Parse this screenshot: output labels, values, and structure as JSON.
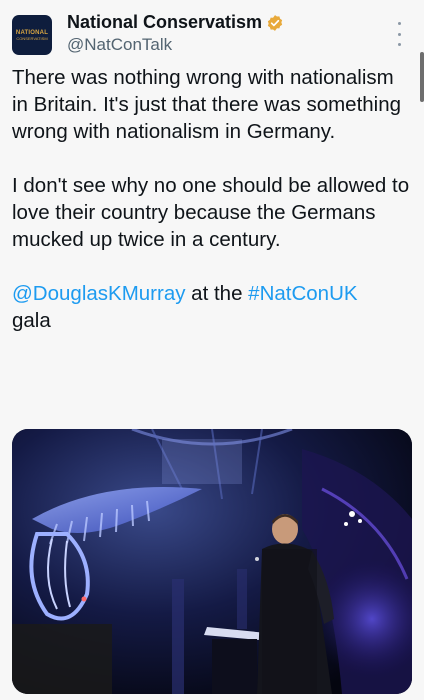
{
  "author": {
    "display_name": "National Conservatism",
    "handle": "@NatConTalk",
    "avatar_text_top": "NATIONAL",
    "avatar_text_bottom": "CONSERVATISM",
    "verified": true,
    "verified_color": "#e8a93a"
  },
  "tweet": {
    "paragraph1": "There was nothing wrong with nationalism in Britain. It's just that there was something wrong with nationalism in Germany.",
    "paragraph2": "I don't see why no one should be allowed to love their country because the Germans mucked up twice in a century.",
    "mention": "@DouglasKMurray",
    "connector": " at the ",
    "hashtag": "#NatConUK",
    "tail": "gala",
    "link_color": "#1d9bf0"
  },
  "media": {
    "description_icon": "photo-icon"
  },
  "icons": {
    "more": "more-vertical-icon",
    "verified": "verified-badge-icon"
  }
}
